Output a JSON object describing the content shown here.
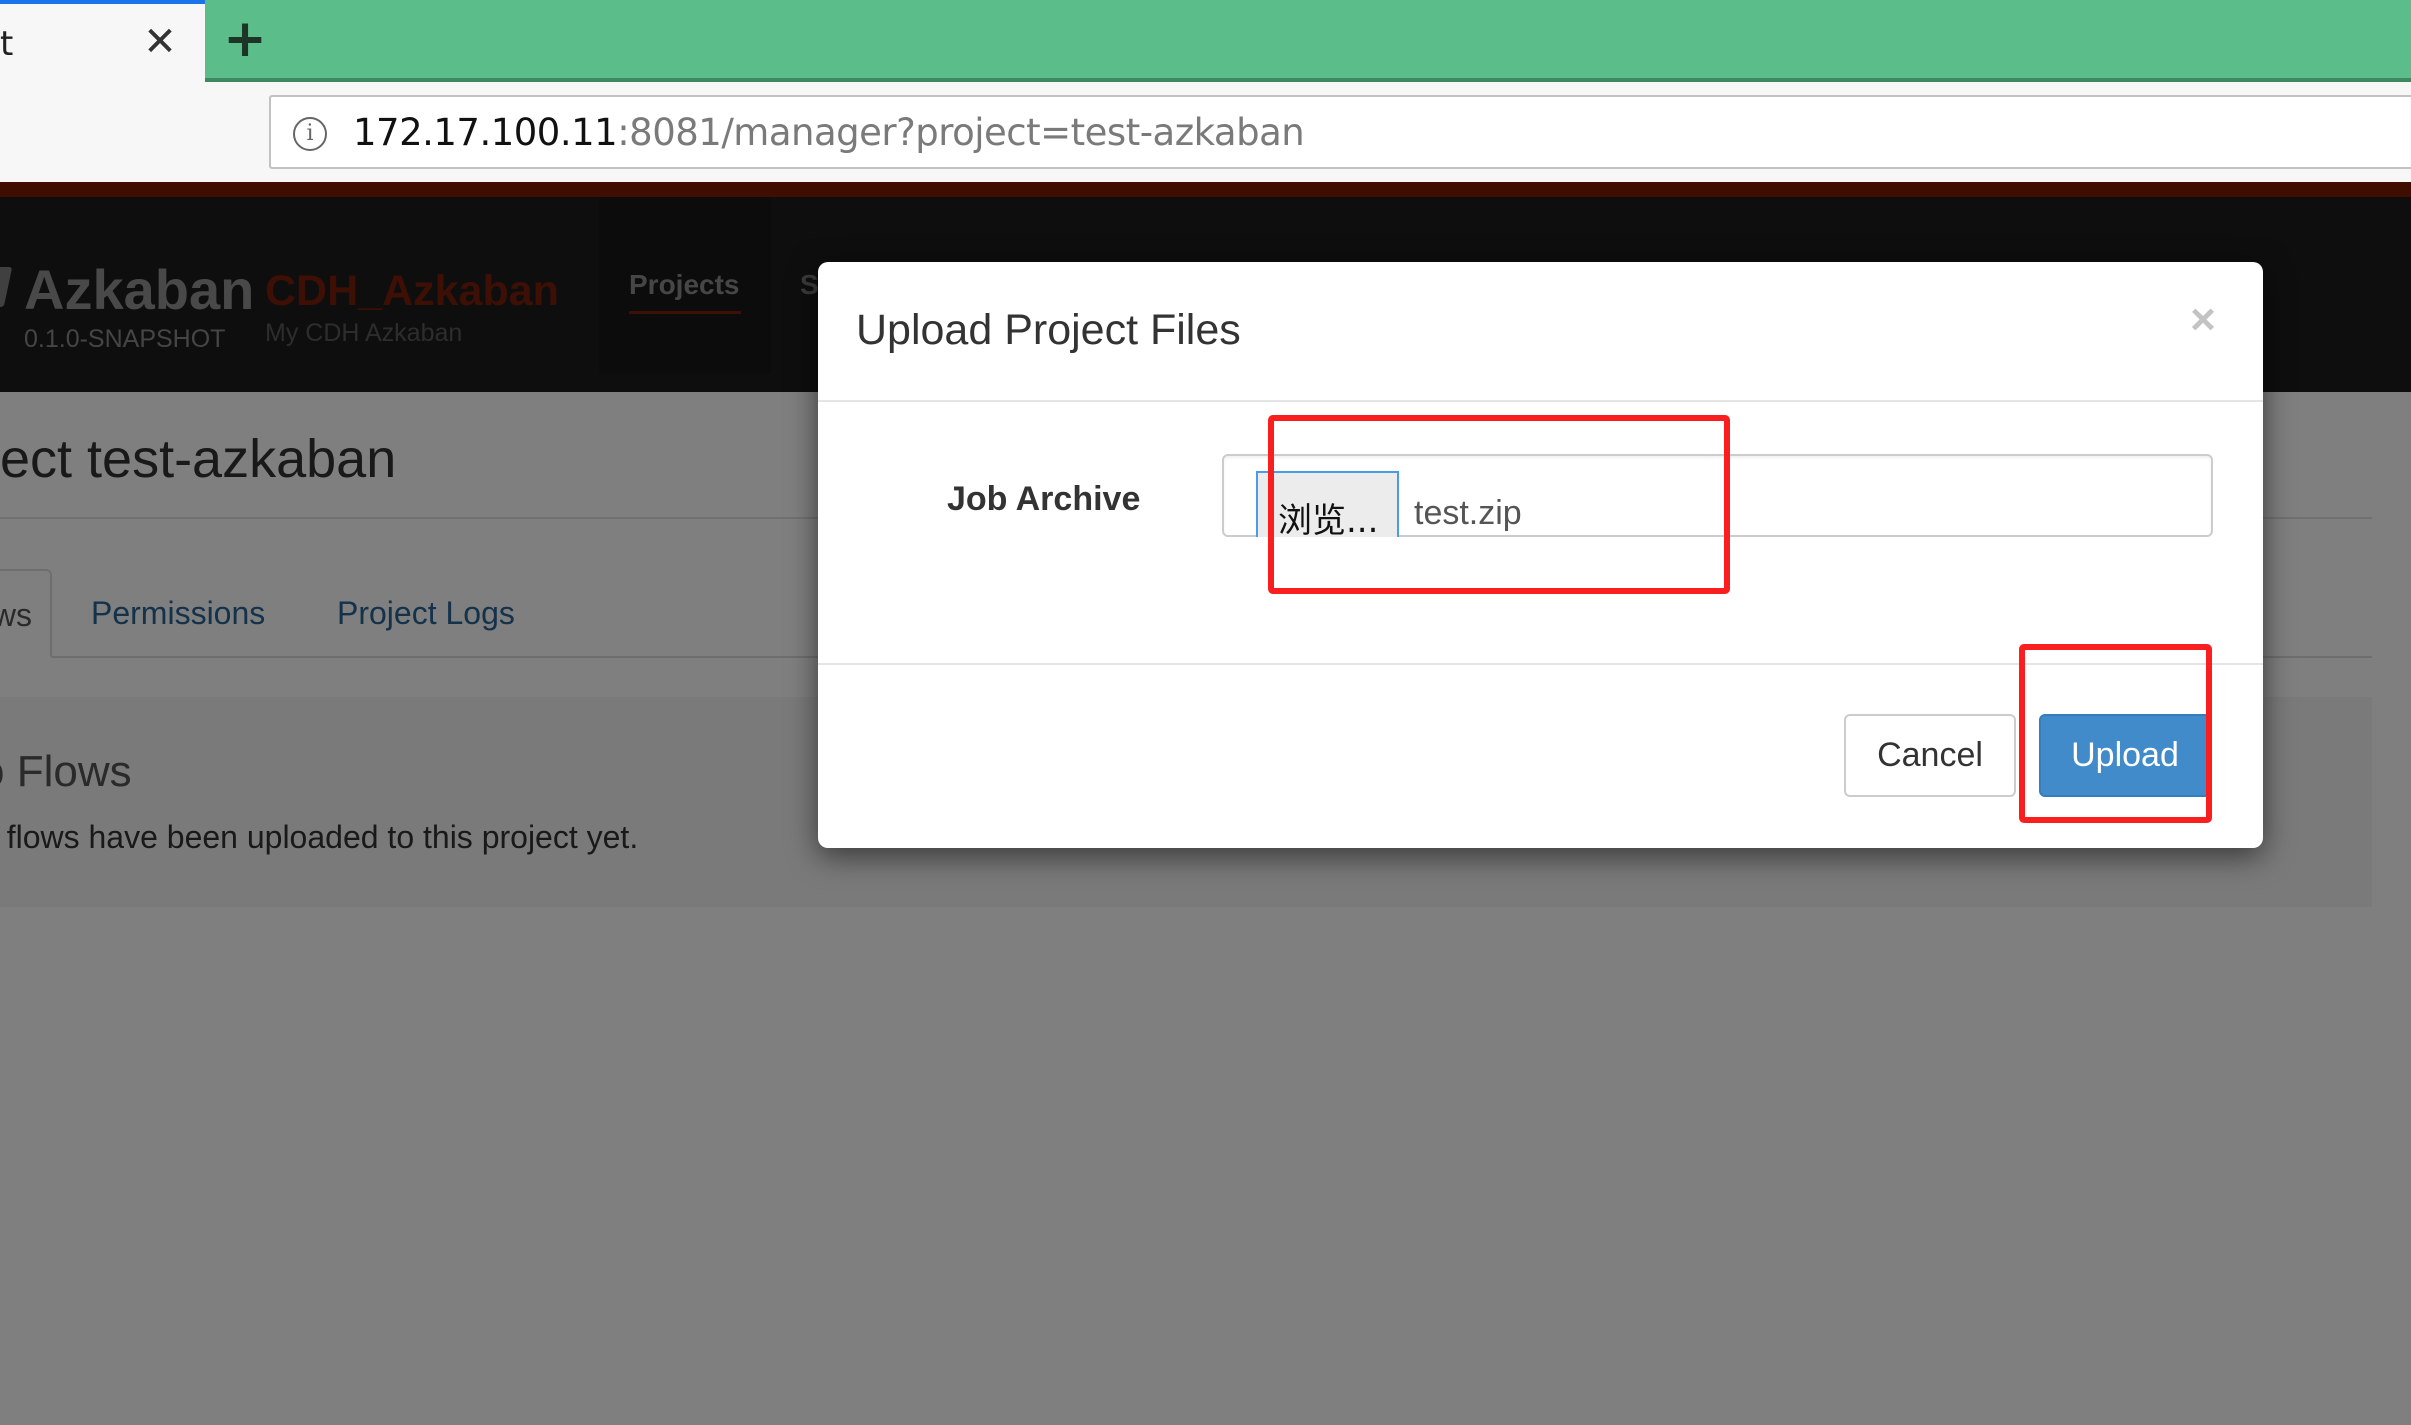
{
  "browser": {
    "tab_title_fragment": "t",
    "tab_close_icon": "close-icon",
    "new_tab_icon": "plus-icon",
    "url": {
      "info_icon": "info-icon",
      "info_glyph": "i",
      "host": "172.17.100.11",
      "rest": ":8081/manager?project=test-azkaban"
    }
  },
  "app": {
    "brand": "Azkaban",
    "version": "0.1.0-SNAPSHOT",
    "instance_name": "CDH_Azkaban",
    "instance_description": "My CDH Azkaban",
    "nav": [
      {
        "label": "Projects",
        "active": true
      },
      {
        "label": "S",
        "active": false
      }
    ],
    "colors": {
      "accent_red": "#7f1c03",
      "header_bg": "#1c1c1c",
      "link_blue": "#2a6496",
      "primary_button": "#428bca",
      "annotation_red": "#fa1f1f"
    }
  },
  "page": {
    "title_fragment": "ect test-azkaban",
    "tabs": [
      {
        "label": "ws",
        "active": true
      },
      {
        "label": "Permissions",
        "active": false
      },
      {
        "label": "Project Logs",
        "active": false
      }
    ],
    "empty_title_fragment": "o Flows",
    "empty_message_fragment": "o flows have been uploaded to this project yet."
  },
  "modal": {
    "title": "Upload Project Files",
    "close_glyph": "×",
    "field_label": "Job Archive",
    "browse_label": "浏览...",
    "selected_file": "test.zip",
    "cancel_label": "Cancel",
    "upload_label": "Upload"
  },
  "annotations": [
    {
      "target": "file-input",
      "color": "#fa1f1f"
    },
    {
      "target": "upload-button",
      "color": "#fa1f1f"
    }
  ]
}
